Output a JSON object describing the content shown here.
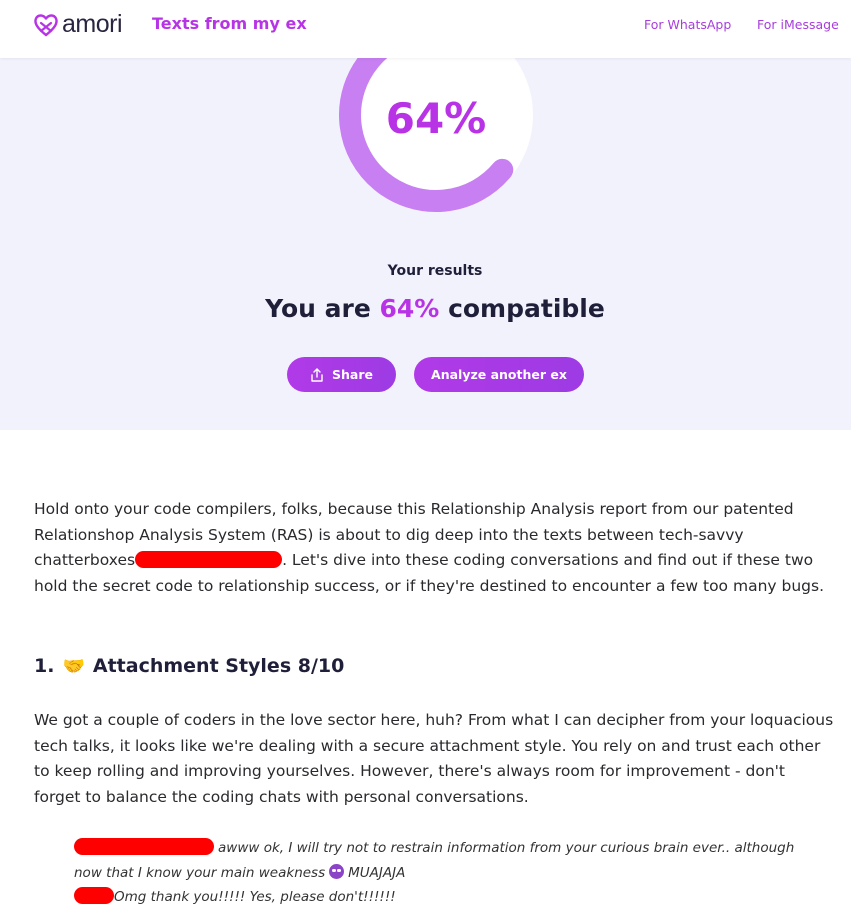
{
  "header": {
    "logo_text": "amori",
    "title": "Texts from my ex",
    "nav": [
      {
        "label": "For WhatsApp"
      },
      {
        "label": "For iMessage"
      }
    ]
  },
  "hero": {
    "gauge_percent": "64%",
    "gauge_fraction": 0.64,
    "results_label": "Your results",
    "compat_prefix": "You are ",
    "compat_value": "64%",
    "compat_suffix": " compatible",
    "share_label": "Share",
    "analyze_label": "Analyze another ex"
  },
  "article": {
    "intro_before_redaction": "Hold onto your code compilers, folks, because this Relationship Analysis report from our patented Relationshop Analysis System (RAS) is about to dig deep into the texts between tech-savvy chatterboxes",
    "intro_after_redaction": ". Let's dive into these coding conversations and find out if these two hold the secret code to relationship success, or if they're destined to encounter a few too many bugs.",
    "section_number": "1.",
    "section_emoji": "🤝",
    "section_title": "Attachment Styles 8/10",
    "section_body": "We got a couple of coders in the love sector here, huh? From what I can decipher from your loquacious tech talks, it looks like we're dealing with a secure attachment style. You rely on and trust each other to keep rolling and improving yourselves. However, there's always room for improvement - don't forget to balance the coding chats with personal conversations.",
    "quote_line1": "awww ok, I will try not to restrain information from your curious brain ever.. although now that I know your main weakness",
    "quote_line1_end": "MUAJAJA",
    "quote_line2": "Omg thank you!!!!! Yes, please don't!!!!!!"
  },
  "colors": {
    "brand": "#b733e6",
    "gauge_fill": "#c77ff2",
    "hero_bg": "#f2f2fc",
    "redaction": "#ff0000"
  },
  "icons": [
    "heart-logo-icon",
    "share-icon",
    "handshake-icon",
    "smiling-face-with-horns-icon"
  ]
}
